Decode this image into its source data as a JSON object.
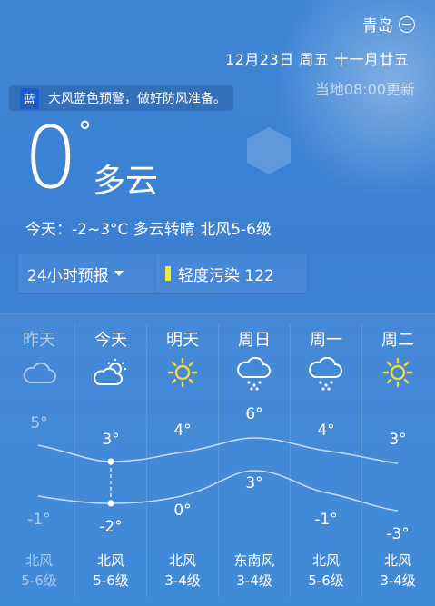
{
  "location": {
    "city": "青岛"
  },
  "date_line": "12月23日 周五 十一月廿五",
  "update_time": "当地08:00更新",
  "warning": {
    "badge": "蓝",
    "text": "大风蓝色预警，做好防风准备。"
  },
  "current": {
    "temperature": "0",
    "degree_symbol": "°",
    "condition": "多云"
  },
  "today_summary": "今天：-2~3°C  多云转晴 北风5-6级",
  "forecast_button": "24小时预报",
  "aqi": {
    "label": "轻度污染 122",
    "color": "#f2e93d"
  },
  "days": [
    {
      "name": "昨天",
      "icon": "cloud-icon",
      "high": "5°",
      "low": "-1°",
      "wind_dir": "北风",
      "wind_level": "5-6级"
    },
    {
      "name": "今天",
      "icon": "partly-cloudy-icon",
      "high": "3°",
      "low": "-2°",
      "wind_dir": "北风",
      "wind_level": "5-6级"
    },
    {
      "name": "明天",
      "icon": "sun-icon",
      "high": "4°",
      "low": "0°",
      "wind_dir": "北风",
      "wind_level": "3-4级"
    },
    {
      "name": "周日",
      "icon": "snow-cloud-icon",
      "high": "6°",
      "low": "3°",
      "wind_dir": "东南风",
      "wind_level": "3-4级"
    },
    {
      "name": "周一",
      "icon": "snow-cloud-icon",
      "high": "4°",
      "low": "-1°",
      "wind_dir": "北风",
      "wind_level": "5-6级"
    },
    {
      "name": "周二",
      "icon": "sun-icon",
      "high": "3°",
      "low": "-3°",
      "wind_dir": "北风",
      "wind_level": "3-4级"
    }
  ],
  "colors": {
    "sun": "#f4d93a"
  }
}
